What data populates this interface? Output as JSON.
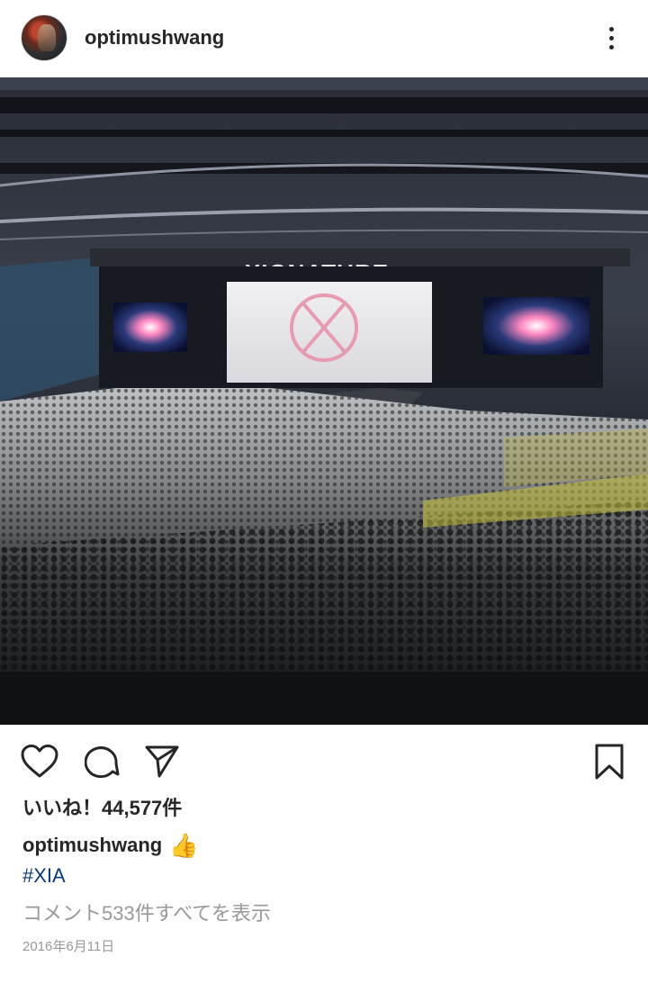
{
  "post": {
    "username": "optimushwang",
    "likes_text": "いいね！44,577件",
    "caption_user": "optimushwang",
    "caption_emoji": "👍",
    "hashtag": "#XIA",
    "view_comments": "コメント533件すべてを表示",
    "date": "2016年6月11日"
  },
  "photo": {
    "stage_banner": "XIGNATURE"
  },
  "icons": {
    "avatar": "profile-avatar",
    "more": "vertical-ellipsis-icon",
    "like": "heart-icon",
    "comment": "comment-bubble-icon",
    "share": "paper-plane-icon",
    "save": "bookmark-icon"
  },
  "colors": {
    "text": "#262626",
    "muted": "#999999",
    "hashtag": "#0a3a7a"
  }
}
